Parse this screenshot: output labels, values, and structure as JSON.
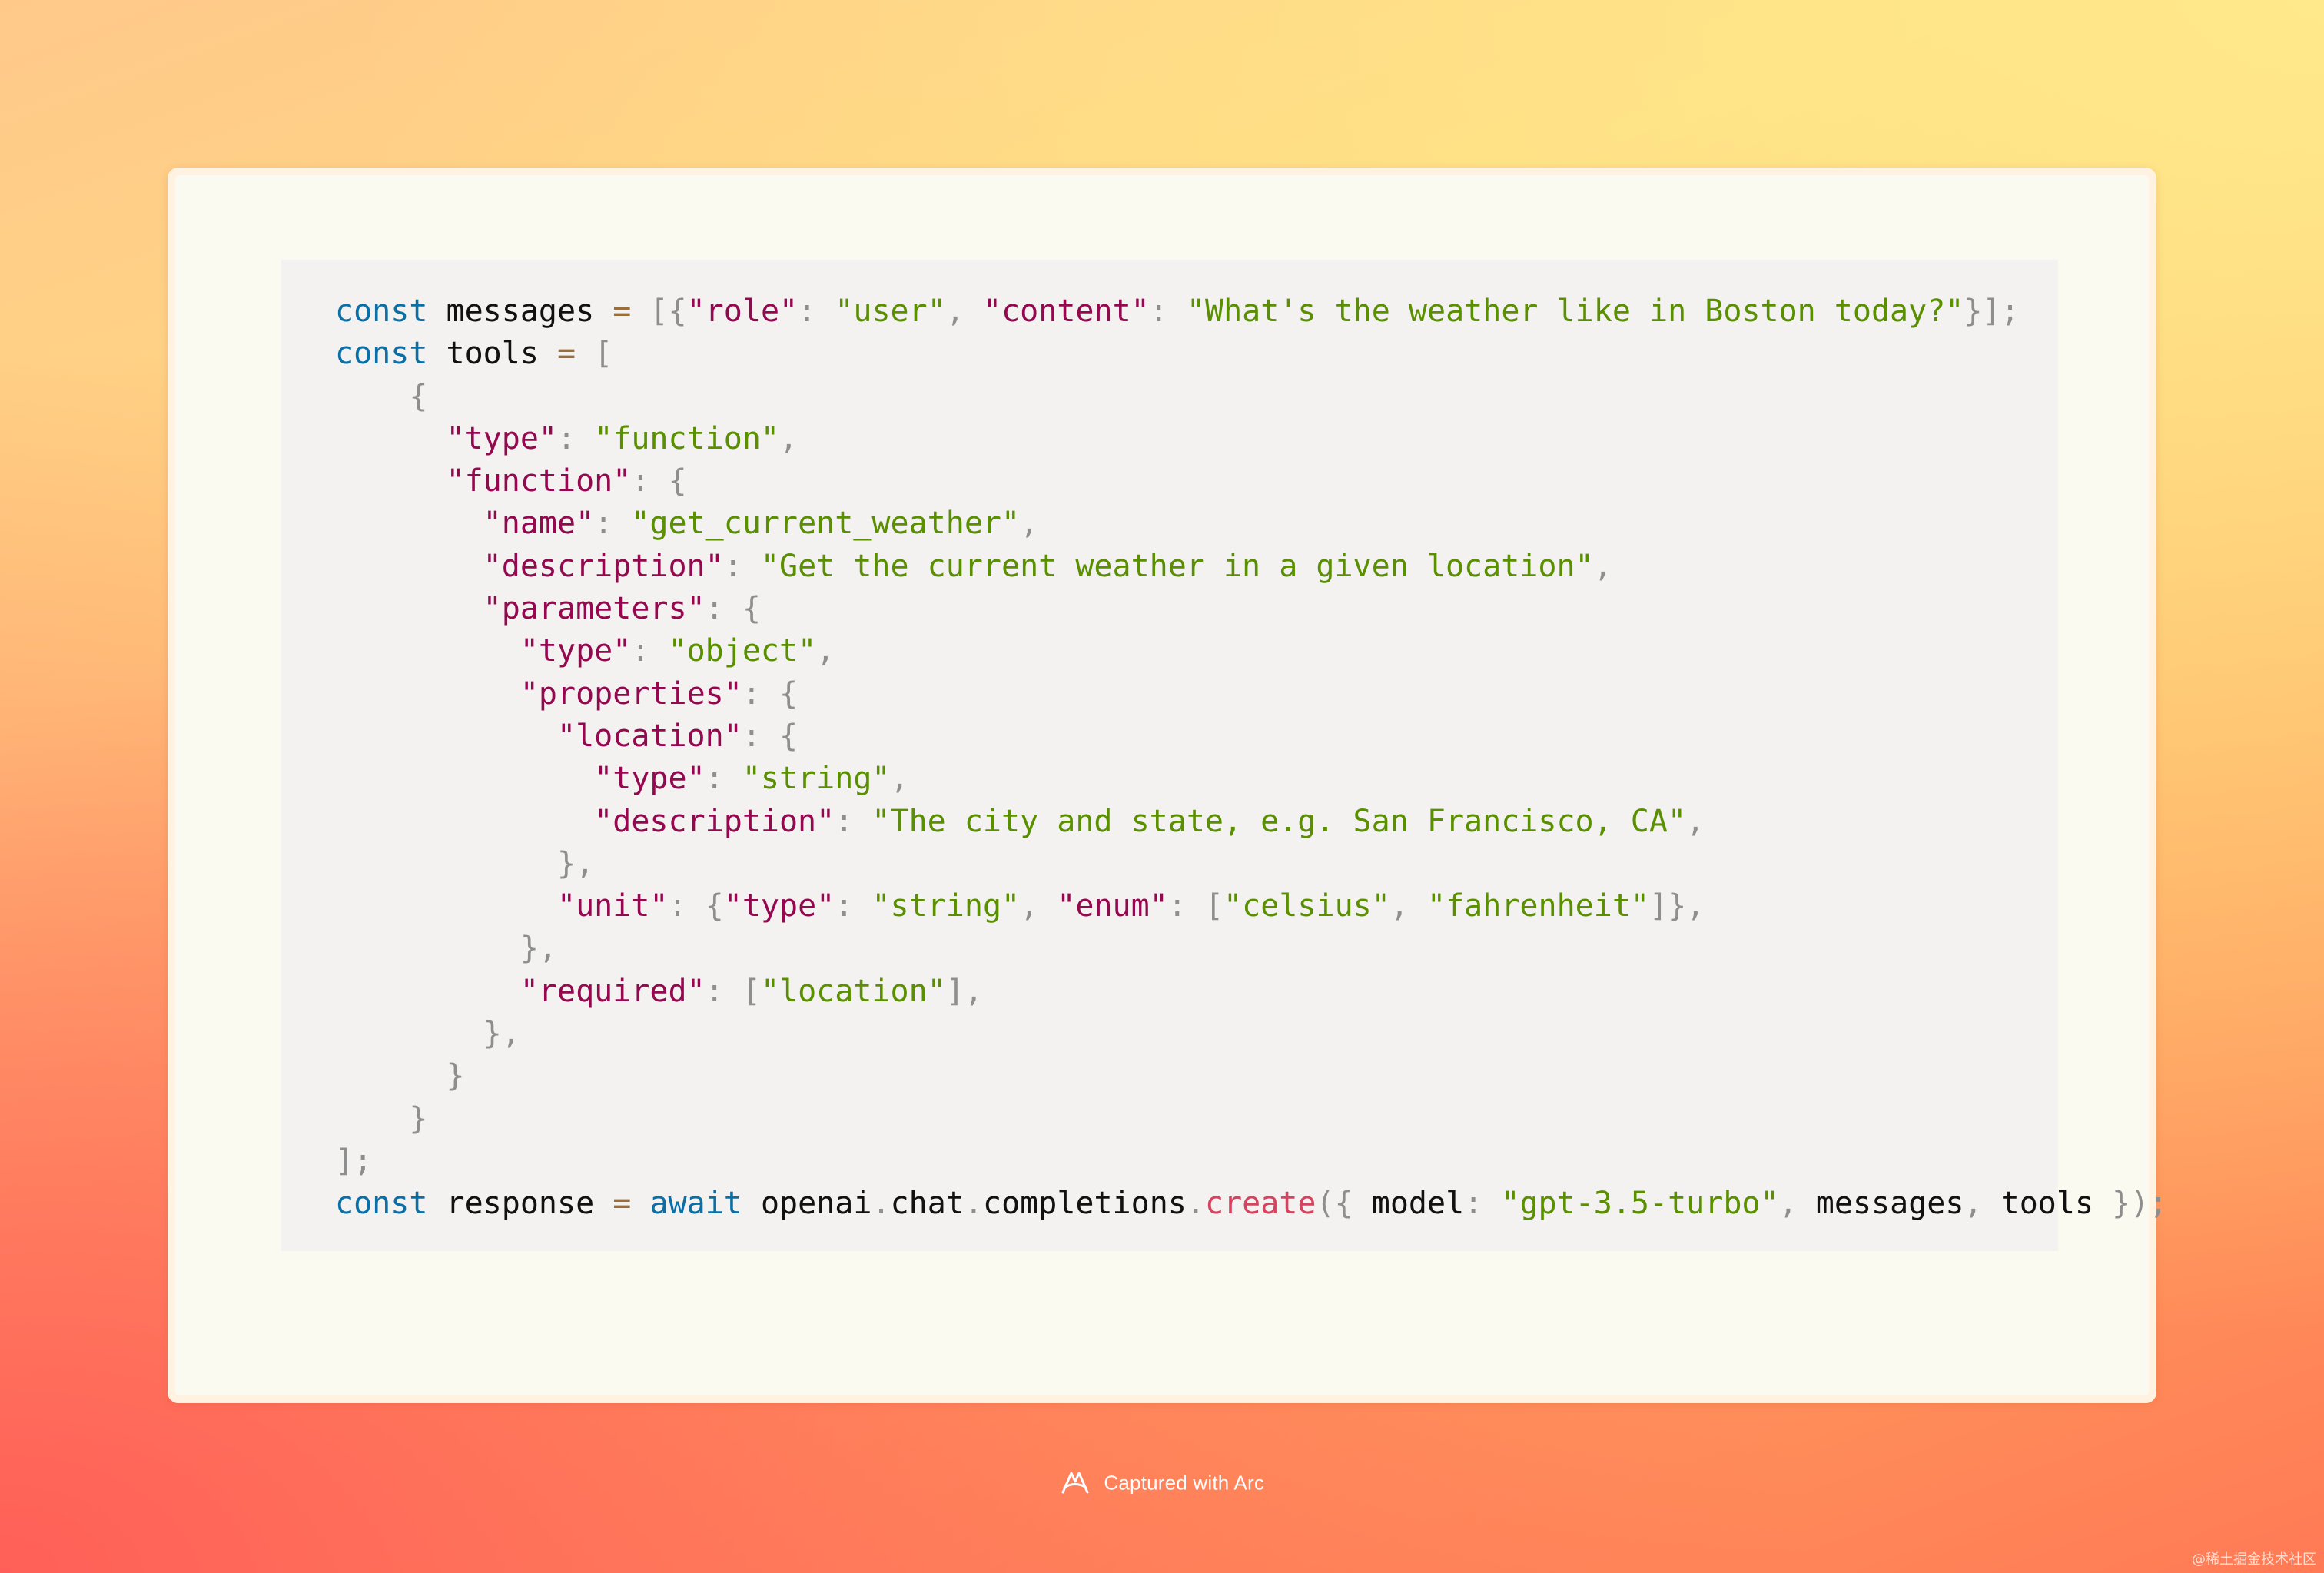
{
  "code": {
    "lines": [
      [
        "const",
        " ",
        "messages",
        " ",
        "=",
        " ",
        "[{",
        "\"role\"",
        ":",
        " ",
        "\"user\"",
        ",",
        " ",
        "\"content\"",
        ":",
        " ",
        "\"What's the weather like in Boston today?\"",
        "}];"
      ],
      [
        "const",
        " ",
        "tools",
        " ",
        "=",
        " ",
        "["
      ],
      [
        "    ",
        "{"
      ],
      [
        "      ",
        "\"type\"",
        ":",
        " ",
        "\"function\"",
        ","
      ],
      [
        "      ",
        "\"function\"",
        ":",
        " ",
        "{"
      ],
      [
        "        ",
        "\"name\"",
        ":",
        " ",
        "\"get_current_weather\"",
        ","
      ],
      [
        "        ",
        "\"description\"",
        ":",
        " ",
        "\"Get the current weather in a given location\"",
        ","
      ],
      [
        "        ",
        "\"parameters\"",
        ":",
        " ",
        "{"
      ],
      [
        "          ",
        "\"type\"",
        ":",
        " ",
        "\"object\"",
        ","
      ],
      [
        "          ",
        "\"properties\"",
        ":",
        " ",
        "{"
      ],
      [
        "            ",
        "\"location\"",
        ":",
        " ",
        "{"
      ],
      [
        "              ",
        "\"type\"",
        ":",
        " ",
        "\"string\"",
        ","
      ],
      [
        "              ",
        "\"description\"",
        ":",
        " ",
        "\"The city and state, e.g. San Francisco, CA\"",
        ","
      ],
      [
        "            ",
        "},"
      ],
      [
        "            ",
        "\"unit\"",
        ":",
        " ",
        "{",
        "\"type\"",
        ":",
        " ",
        "\"string\"",
        ",",
        " ",
        "\"enum\"",
        ":",
        " ",
        "[",
        "\"celsius\"",
        ",",
        " ",
        "\"fahrenheit\"",
        "]},"
      ],
      [
        "          ",
        "},"
      ],
      [
        "          ",
        "\"required\"",
        ":",
        " ",
        "[",
        "\"location\"",
        "],"
      ],
      [
        "        ",
        "},"
      ],
      [
        "      ",
        "}"
      ],
      [
        "    ",
        "}"
      ],
      [
        "",
        "];"
      ],
      [
        "const",
        " ",
        "response",
        " ",
        "=",
        " ",
        "await",
        " ",
        "openai",
        ".",
        "chat",
        ".",
        "completions",
        ".",
        "create",
        "({",
        " ",
        "model",
        ":",
        " ",
        "\"gpt-3.5-turbo\"",
        ",",
        " ",
        "messages",
        ",",
        " ",
        "tools",
        " ",
        "});"
      ]
    ]
  },
  "footer": {
    "caption": "Captured with Arc",
    "icon": "arc-logo-icon"
  },
  "watermark": "@稀土掘金技术社区",
  "colors": {
    "keyword": "#0a6fa6",
    "json_key": "#93084e",
    "string": "#5a8f00",
    "method": "#d6435f",
    "punctuation": "#8e8e8e"
  }
}
